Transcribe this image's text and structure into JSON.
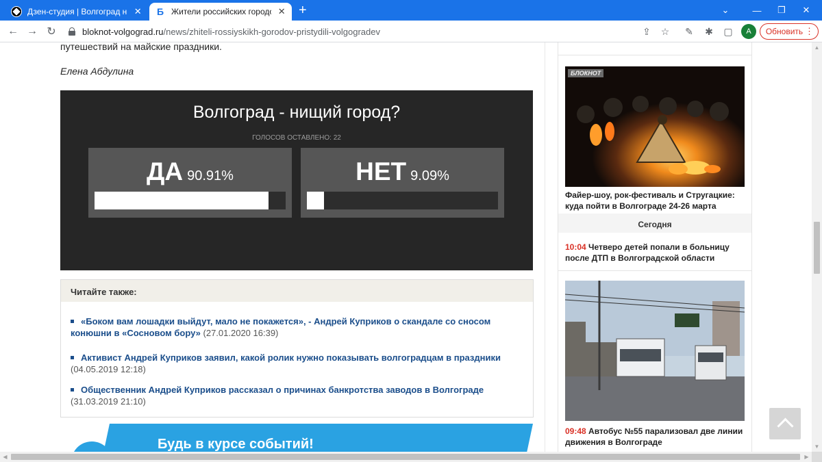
{
  "browser": {
    "tabs": [
      {
        "title": "Дзен-студия | Волгоград нищий",
        "close": "✕"
      },
      {
        "title": "Жители российских городов пр",
        "close": "✕",
        "favicon_letter": "Б"
      }
    ],
    "new_tab": "+",
    "window_controls": {
      "collapse": "⌄",
      "minimize": "—",
      "maximize": "❐",
      "close": "✕"
    },
    "nav": {
      "back": "←",
      "forward": "→",
      "reload": "↻"
    },
    "url_host": "bloknot-volgograd.ru",
    "url_path": "/news/zhiteli-rossiyskikh-gorodov-pristydili-volgogradev",
    "tools": {
      "share": "⇪",
      "bookmark": "☆",
      "extension": "✎",
      "puzzle": "✱",
      "sidebar": "▢"
    },
    "profile_letter": "A",
    "update_label": "Обновить",
    "menu": "⋮"
  },
  "article": {
    "top_text": "путешествий на майские праздники.",
    "author": "Елена Абдулина"
  },
  "poll": {
    "question": "Волгоград - нищий город?",
    "votes_text": "ГОЛОСОВ ОСТАВЛЕНО: 22",
    "options": [
      {
        "label": "ДА",
        "percent_text": "90.91%",
        "share": 0.9091
      },
      {
        "label": "НЕТ",
        "percent_text": "9.09%",
        "share": 0.0909
      }
    ]
  },
  "read_also": {
    "heading": "Читайте также:",
    "items": [
      {
        "title": "«Боком вам лошадки выйдут, мало не покажется», - Андрей Куприков о скандале со сносом конюшни в «Сосновом бору»",
        "date": "(27.01.2020 16:39)"
      },
      {
        "title": "Активист Андрей Куприков заявил, какой ролик нужно показывать волгоградцам в праздники",
        "date": "(04.05.2019 12:18)"
      },
      {
        "title": "Общественник Андрей Куприков рассказал о причинах банкротства заводов в Волгограде",
        "date": "(31.03.2019 21:10)"
      }
    ]
  },
  "subscribe": {
    "title": "Будь в курсе событий!"
  },
  "sidebar": {
    "news": [
      {
        "time": "",
        "title": "Файер-шоу, рок-фестиваль и Стругацкие: куда пойти в Волгограде 24-26 марта",
        "photo_badge": "БЛОКНОТ"
      },
      {
        "time": "10:04",
        "title": " Четверо детей попали в больницу после ДТП в Волгоградской области"
      },
      {
        "time": "09:48",
        "title": " Автобус №55 парализовал две линии движения в Волгограде"
      }
    ],
    "today_label": "Сегодня"
  },
  "colors": {
    "chrome_blue": "#1a73e8",
    "poll_bg": "#262626",
    "option_bg": "#565656",
    "link": "#1b4e8b",
    "time_red": "#d93025",
    "subscribe_blue": "#2aa2e2"
  }
}
